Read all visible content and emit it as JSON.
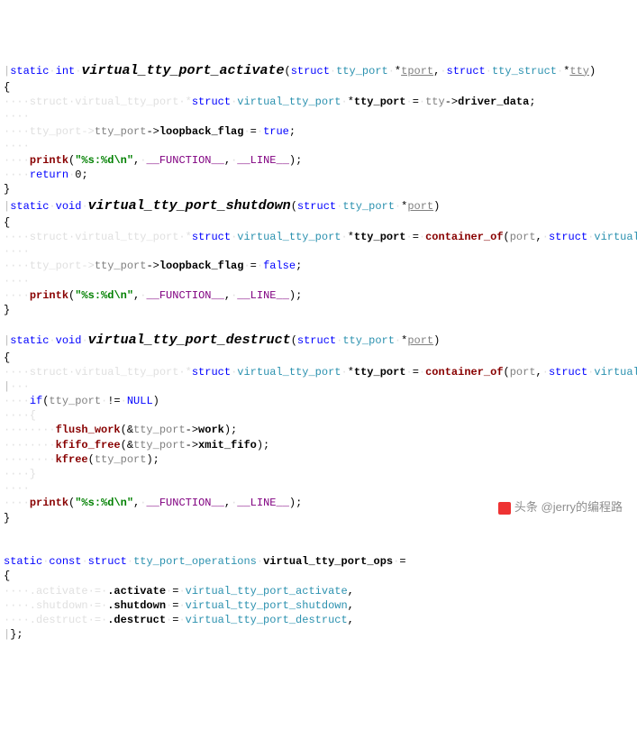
{
  "fn1": {
    "sig_pre": "static·int·",
    "name": "virtual_tty_port_activate",
    "params": "(struct·tty_port·*tport,·struct·tty_struct·*tty)",
    "body1a": "····struct·virtual_tty_port·*",
    "body1b": "tty_port",
    "body1c": "·=·tty->",
    "body1d": "driver_data",
    "body1e": ";",
    "body2a": "····tty_port->",
    "body2b": "loopback_flag",
    "body2c": "·=·",
    "body2d": "true",
    "body2e": ";",
    "pr_lead": "····",
    "pr_fn": "printk",
    "pr_open": "(",
    "pr_str": "\"%s:%d\\n\"",
    "pr_mid": ",·",
    "pr_m1": "__FUNCTION__",
    "pr_mid2": ",·",
    "pr_m2": "__LINE__",
    "pr_close": ");",
    "ret_lead": "····",
    "ret": "return",
    "ret_v": "·0;"
  },
  "fn2": {
    "sig_pre": "static·void·",
    "name": "virtual_tty_port_shutdown",
    "params": "(struct·tty_port·*port)",
    "body1a": "····struct·virtual_tty_port·*",
    "body1b": "tty_port",
    "body1c": "·=·",
    "body1d": "container_of",
    "body1e": "(port,·struct·virtual_tty_port,·port);",
    "body2a": "····tty_port->",
    "body2b": "loopback_flag",
    "body2c": "·=·",
    "body2d": "false",
    "body2e": ";",
    "pr_lead": "····",
    "pr_fn": "printk",
    "pr_open": "(",
    "pr_str": "\"%s:%d\\n\"",
    "pr_mid": ",·",
    "pr_m1": "__FUNCTION__",
    "pr_mid2": ",·",
    "pr_m2": "__LINE__",
    "pr_close": ");"
  },
  "fn3": {
    "sig_pre": "static·void·",
    "name": "virtual_tty_port_destruct",
    "params": "(struct·tty_port·*port)",
    "body1a": "····struct·virtual_tty_port·*",
    "body1b": "tty_port",
    "body1c": "·=·",
    "body1d": "container_of",
    "body1e": "(port,·struct·virtual_tty_port,·port);",
    "if_lead": "····",
    "if_kw": "if",
    "if_open": "(tty_port·!=·",
    "if_null": "NULL",
    "if_close": ")",
    "ob": "····{",
    "l1_lead": "········",
    "l1_fn": "flush_work",
    "l1_args": "(&tty_port->work);",
    "l2_lead": "········",
    "l2_fn": "kfifo_free",
    "l2_args": "(&tty_port->xmit_fifo);",
    "l3_lead": "········",
    "l3_fn": "kfree",
    "l3_args": "(tty_port);",
    "cb": "····}",
    "pr_lead": "····",
    "pr_fn": "printk",
    "pr_open": "(",
    "pr_str": "\"%s:%d\\n\"",
    "pr_mid": ",·",
    "pr_m1": "__FUNCTION__",
    "pr_mid2": ",·",
    "pr_m2": "__LINE__",
    "pr_close": ");"
  },
  "ops": {
    "decl_pre": "static·const·struct·",
    "decl_type": "tty_port_operations",
    "decl_var": "·virtual_tty_port_ops·=",
    "l1a": "····.activate·=·",
    "l1b": "virtual_tty_port_activate",
    "l2a": "····.shutdown·=·",
    "l2b": "virtual_tty_port_shutdown",
    "l3a": "····.destruct·=·",
    "l3b": "virtual_tty_port_destruct",
    "comma": ","
  },
  "brace_open": "{",
  "brace_close": "}",
  "brace_close_semi": "};",
  "pipe": "|",
  "blank4": "····",
  "watermark": "头条 @jerry的编程路"
}
